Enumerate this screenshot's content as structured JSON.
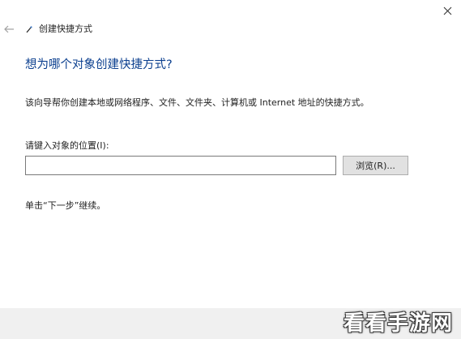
{
  "window": {
    "title": "创建快捷方式"
  },
  "icons": {
    "close": "close-icon",
    "back": "back-arrow-icon",
    "wizard": "shortcut-wizard-icon"
  },
  "main": {
    "heading": "想为哪个对象创建快捷方式?",
    "description": "该向导帮你创建本地或网络程序、文件、文件夹、计算机或 Internet 地址的快捷方式。",
    "location_label": "请键入对象的位置(I):",
    "location_value": "",
    "browse_label": "浏览(R)...",
    "next_hint": "单击“下一步”继续。"
  },
  "watermark": {
    "text": "看看手游网"
  },
  "colors": {
    "heading": "#0b3f8f",
    "footer_bg": "#f0f0f0",
    "button_bg": "#e1e1e1"
  }
}
